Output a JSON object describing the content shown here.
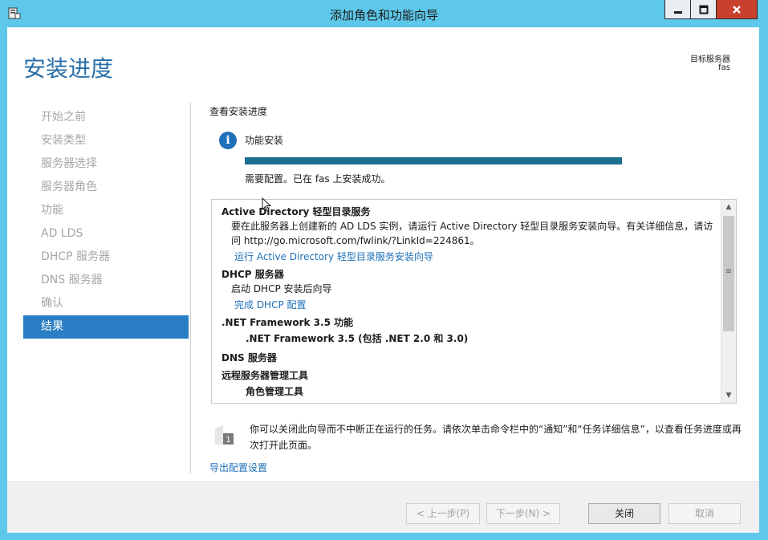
{
  "window": {
    "title": "添加角色和功能向导",
    "min_glyph": "—",
    "max_glyph": "□",
    "close_glyph": "✕"
  },
  "header": {
    "title": "安装进度",
    "target_label": "目标服务器",
    "target_name": "fas"
  },
  "nav": {
    "items": [
      {
        "label": "开始之前"
      },
      {
        "label": "安装类型"
      },
      {
        "label": "服务器选择"
      },
      {
        "label": "服务器角色"
      },
      {
        "label": "功能"
      },
      {
        "label": "AD LDS"
      },
      {
        "label": "DHCP 服务器"
      },
      {
        "label": "DNS 服务器"
      },
      {
        "label": "确认"
      },
      {
        "label": "结果"
      }
    ],
    "active": "结果"
  },
  "main": {
    "view_label": "查看安装进度",
    "feature_label": "功能安装",
    "progress_fraction": 1.0,
    "status_message": "需要配置。已在 fas 上安装成功。",
    "results": {
      "adlds_title": "Active Directory 轻型目录服务",
      "adlds_text": "要在此服务器上创建新的 AD LDS 实例，请运行 Active Directory 轻型目录服务安装向导。有关详细信息，请访问 http://go.microsoft.com/fwlink/?LinkId=224861。",
      "adlds_link": "运行 Active Directory 轻型目录服务安装向导",
      "dhcp_title": "DHCP 服务器",
      "dhcp_text": "启动 DHCP 安装后向导",
      "dhcp_link": "完成 DHCP 配置",
      "netfx_title": ".NET Framework 3.5 功能",
      "netfx_sub": ".NET Framework 3.5 (包括 .NET 2.0 和 3.0)",
      "dns_title": "DNS 服务器",
      "rsat_title": "远程服务器管理工具",
      "rsat_sub": "角色管理工具"
    },
    "note": "你可以关闭此向导而不中断正在运行的任务。请依次单击命令栏中的“通知”和“任务详细信息”，以查看任务进度或再次打开此页面。",
    "export_link": "导出配置设置"
  },
  "footer": {
    "prev_label": "< 上一步(P)",
    "next_label": "下一步(N) >",
    "close_label": "关闭",
    "cancel_label": "取消"
  },
  "colors": {
    "title_bar": "#5ec8ea",
    "accent": "#2a7ec3",
    "header_text": "#2a6fa8",
    "link": "#1f70b8",
    "progress": "#1d6f8f",
    "close_button": "#c7412c"
  }
}
